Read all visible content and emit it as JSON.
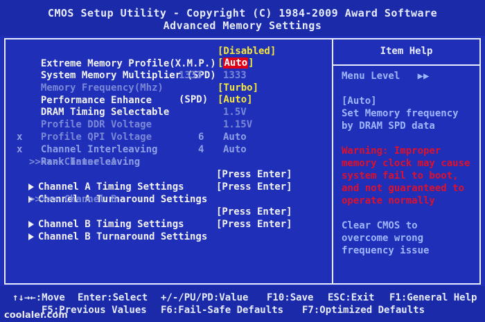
{
  "header": {
    "title": "CMOS Setup Utility - Copyright (C) 1984-2009 Award Software",
    "subtitle": "Advanced Memory Settings"
  },
  "items": [
    {
      "label": "Extreme Memory Profile(X.M.P.)",
      "value": "[Disabled]"
    },
    {
      "label": "System Memory Multiplier (SPD)",
      "value": "Auto"
    },
    {
      "label": "Memory Frequency(Mhz)",
      "value2": "1333",
      "value": "1333"
    },
    {
      "label": "Performance Enhance",
      "value": "[Turbo]"
    },
    {
      "label": "DRAM Timing Selectable",
      "mid": "(SPD)",
      "value": "[Auto]"
    },
    {
      "label": "Profile DDR Voltage",
      "value": "1.5V"
    },
    {
      "label": "Profile QPI Voltage",
      "value": "1.15V"
    },
    {
      "label": "Channel Interleaving",
      "mid": "6",
      "value": "Auto"
    },
    {
      "label": "Rank Interleaving",
      "mid": "4",
      "value": "Auto"
    },
    {
      "label": ">>>>> Channel A"
    },
    {
      "label": "Channel A Timing Settings",
      "value": "[Press Enter]"
    },
    {
      "label": "Channel A Turnaround Settings",
      "value": "[Press Enter]"
    },
    {
      "label": ">>>>> Channel B"
    },
    {
      "label": "Channel B Timing Settings",
      "value": "[Press Enter]"
    },
    {
      "label": "Channel B Turnaround Settings",
      "value": "[Press Enter]"
    }
  ],
  "help": {
    "title": "Item Help",
    "menu_level": "Menu Level   ▶▶",
    "line1": "[Auto]",
    "line2": "Set Memory frequency",
    "line3": "by DRAM SPD data",
    "warn1": "Warning: Improper",
    "warn2": "memory clock may cause",
    "warn3": "system fail to boot,",
    "warn4": "and not guaranteed to",
    "warn5": "operate normally",
    "clear1": "Clear CMOS to",
    "clear2": "overcome wrong",
    "clear3": "frequency issue"
  },
  "footer": {
    "move": "↑↓→←:Move",
    "select": "Enter:Select",
    "value": "+/-/PU/PD:Value",
    "save": "F10:Save",
    "exit": "ESC:Exit",
    "general_help": "F1:General Help",
    "prev": "F5:Previous Values",
    "failsafe": "F6:Fail-Safe Defaults",
    "optimized": "F7:Optimized Defaults"
  },
  "x_marker": "x",
  "watermark": "coolaler.com",
  "colors": {
    "background": "#1f2fb8",
    "selected": "#e00018",
    "value": "#f5e83a",
    "warning": "#e0102a"
  }
}
